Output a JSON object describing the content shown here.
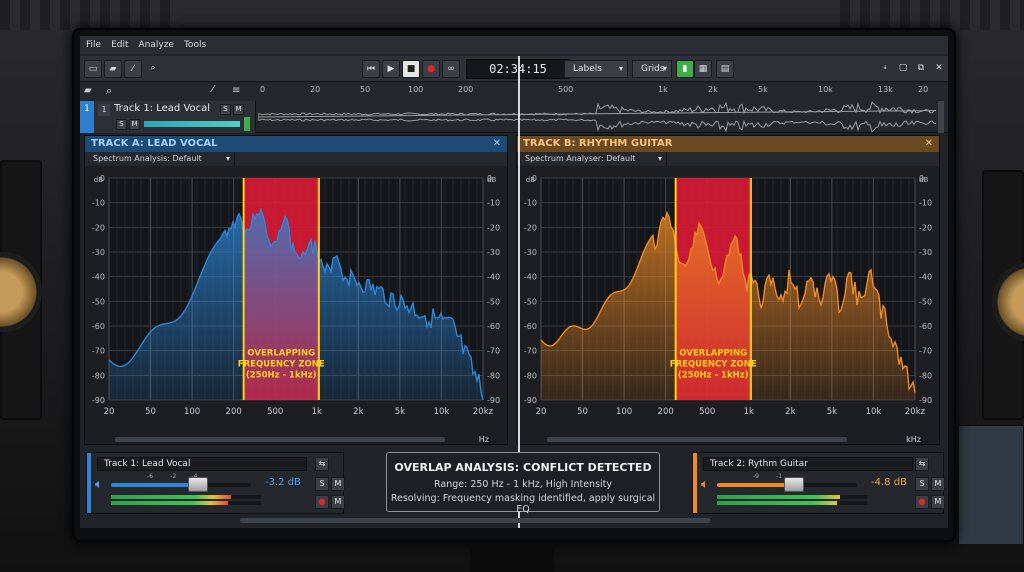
{
  "menu": [
    "File",
    "Edit",
    "Analyze",
    "Tools"
  ],
  "toolbar": {
    "time": "02:34:15",
    "labels_dropdown": "Labels",
    "grids_dropdown": "Grids",
    "icons": [
      "window-icon",
      "folder-icon",
      "wand-icon",
      "zoom-icon",
      "skip-start-icon",
      "play-icon",
      "stop-icon",
      "record-icon",
      "loop-icon",
      "grid-view-icon",
      "meter-icon",
      "layout-icon",
      "tool-icon",
      "panel-icon",
      "tile-icon",
      "close-icon"
    ]
  },
  "timeline": {
    "ruler_ticks": [
      "0",
      "20",
      "50",
      "100",
      "200",
      "500",
      "1k",
      "2k",
      "5k",
      "10k",
      "13k",
      "20"
    ],
    "track": {
      "number": "1",
      "name": "Track 1: Lead Vocal",
      "sub_number": "1",
      "s": "S",
      "m": "M"
    }
  },
  "panels": [
    {
      "id": "a",
      "title": "TRACK A: LEAD VOCAL",
      "analysis_label": "Spectrum Analysis:",
      "analysis_value": "Default",
      "close": "✕",
      "accent": "#2d86d8",
      "zone_label": [
        "OVERLAPPING",
        "FREQUENCY ZONE",
        "(250Hz - 1kHz)"
      ],
      "x_ticks": [
        "20",
        "50",
        "100",
        "200",
        "500",
        "1k",
        "2k",
        "5k",
        "10k",
        "20kz"
      ],
      "x_unit": "Hz",
      "y_ticks": [
        "0",
        "-10",
        "-20",
        "-30",
        "-40",
        "-50",
        "-60",
        "-70",
        "-80",
        "-90"
      ],
      "y_unit": "dB"
    },
    {
      "id": "b",
      "title": "TRACK B: RHYTHM GUITAR",
      "analysis_label": "Spectrum Analyser:",
      "analysis_value": "Default",
      "close": "✕",
      "accent": "#f08a24",
      "zone_label": [
        "OVERLAPPING",
        "FREQUENCY ZONE",
        "(250Hz - 1kHz)"
      ],
      "x_ticks": [
        "20",
        "50",
        "100",
        "200",
        "500",
        "1k",
        "2k",
        "5k",
        "10k",
        "20kz"
      ],
      "x_unit": "kHz",
      "y_ticks": [
        "0",
        "-10",
        "-20",
        "-30",
        "-40",
        "-50",
        "-60",
        "-70",
        "-80",
        "-90"
      ],
      "y_unit": "dB"
    }
  ],
  "mixer": [
    {
      "name": "Track 1: Lead Vocal",
      "db": "-3.2 dB",
      "level": 0.62,
      "accent": "#2d86d8",
      "s": "S",
      "m": "M"
    },
    {
      "name": "Track 2: Rythm Guitar",
      "db": "-4.8 dB",
      "level": 0.55,
      "accent": "#f08a24",
      "s": "S",
      "m": "M"
    }
  ],
  "mixer_scale": [
    "-6",
    "-2",
    "-4",
    "-9",
    "-1"
  ],
  "overlap": {
    "title": "OVERLAP ANALYSIS: CONFLICT DETECTED",
    "range": "Range: 250 Hz - 1 kHz, High Intensity",
    "resolving": "Resolving: Frequency masking identified, apply surgical EQ"
  },
  "colors": {
    "zone": "#e01a35",
    "zone_edge": "#ffd21a",
    "vocal": "#2d86d8",
    "guitar": "#f08a24"
  }
}
